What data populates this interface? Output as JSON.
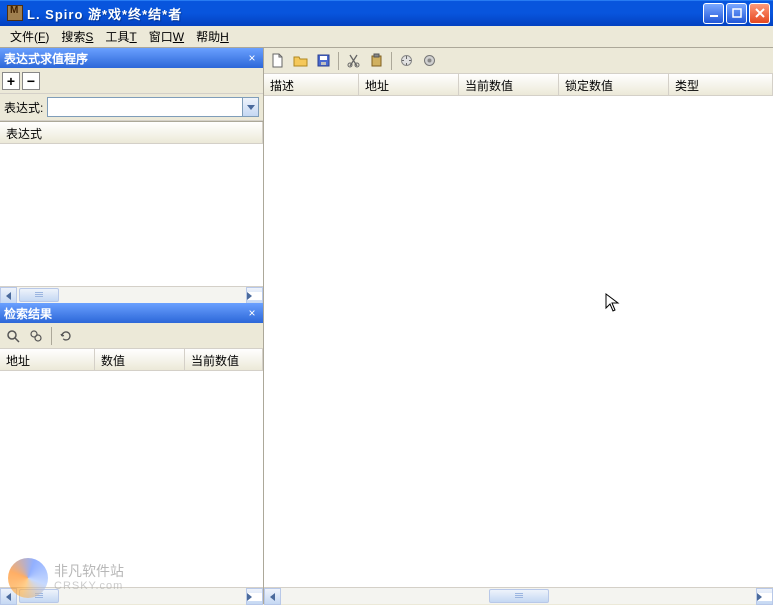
{
  "window": {
    "title": "L. Spiro   游*戏*终*结*者"
  },
  "menu": [
    {
      "label": "文件",
      "mnemonic": "F"
    },
    {
      "label": "搜索",
      "mnemonic": "S"
    },
    {
      "label": "工具",
      "mnemonic": "T"
    },
    {
      "label": "窗口",
      "mnemonic": "W"
    },
    {
      "label": "帮助",
      "mnemonic": "H"
    }
  ],
  "pane_eval": {
    "title": "表达式求值程序",
    "expr_label": "表达式:",
    "expr_value": "",
    "columns": [
      "表达式"
    ]
  },
  "pane_results": {
    "title": "检索结果",
    "columns": [
      "地址",
      "数值",
      "当前数值"
    ]
  },
  "main_table": {
    "columns": [
      "描述",
      "地址",
      "当前数值",
      "锁定数值",
      "类型"
    ]
  },
  "watermark": {
    "name": "非凡软件站",
    "url": "CRSKY.com"
  }
}
